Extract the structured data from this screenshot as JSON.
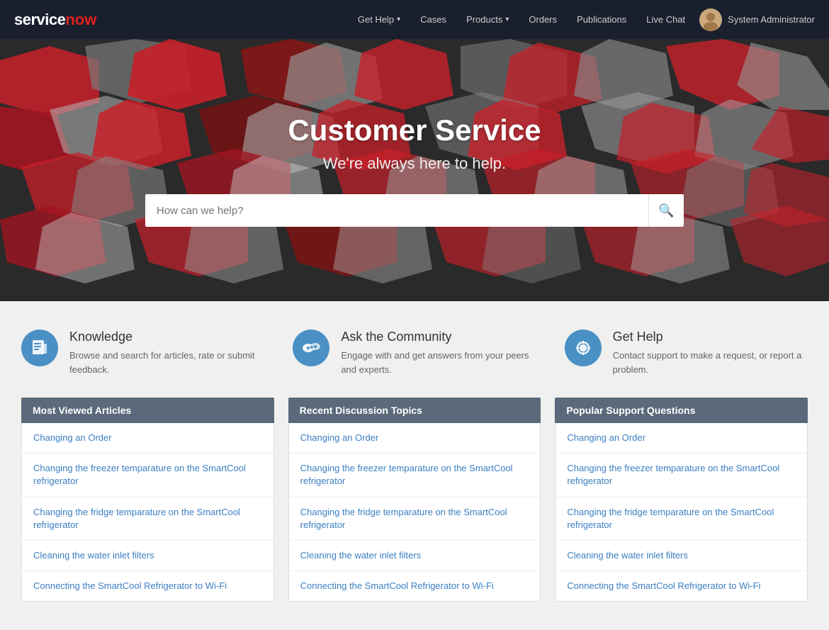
{
  "navbar": {
    "logo_service": "service",
    "logo_now": "now",
    "links": [
      {
        "label": "Get Help",
        "has_caret": true,
        "name": "get-help"
      },
      {
        "label": "Cases",
        "has_caret": false,
        "name": "cases"
      },
      {
        "label": "Products",
        "has_caret": true,
        "name": "products"
      },
      {
        "label": "Orders",
        "has_caret": false,
        "name": "orders"
      },
      {
        "label": "Publications",
        "has_caret": false,
        "name": "publications"
      },
      {
        "label": "Live Chat",
        "has_caret": false,
        "name": "live-chat"
      }
    ],
    "user_name": "System Administrator"
  },
  "hero": {
    "title": "Customer Service",
    "subtitle": "We're always here to help.",
    "search_placeholder": "How can we help?"
  },
  "cards": [
    {
      "icon": "📋",
      "title": "Knowledge",
      "description": "Browse and search for articles, rate or submit feedback.",
      "name": "knowledge-card"
    },
    {
      "icon": "💬",
      "title": "Ask the Community",
      "description": "Engage with and get answers from your peers and experts.",
      "name": "community-card"
    },
    {
      "icon": "🛟",
      "title": "Get Help",
      "description": "Contact support to make a request, or report a problem.",
      "name": "get-help-card"
    }
  ],
  "panels": [
    {
      "header": "Most Viewed Articles",
      "name": "most-viewed-panel",
      "items": [
        "Changing an Order",
        "Changing the freezer temparature on the SmartCool refrigerator",
        "Changing the fridge temparature on the SmartCool refrigerator",
        "Cleaning the water inlet filters",
        "Connecting the SmartCool Refrigerator to Wi-Fi"
      ]
    },
    {
      "header": "Recent Discussion Topics",
      "name": "recent-discussion-panel",
      "items": [
        "Changing an Order",
        "Changing the freezer temparature on the SmartCool refrigerator",
        "Changing the fridge temparature on the SmartCool refrigerator",
        "Cleaning the water inlet filters",
        "Connecting the SmartCool Refrigerator to Wi-Fi"
      ]
    },
    {
      "header": "Popular Support Questions",
      "name": "popular-support-panel",
      "items": [
        "Changing an Order",
        "Changing the freezer temparature on the SmartCool refrigerator",
        "Changing the fridge temparature on the SmartCool refrigerator",
        "Cleaning the water inlet filters",
        "Connecting the SmartCool Refrigerator to Wi-Fi"
      ]
    }
  ]
}
